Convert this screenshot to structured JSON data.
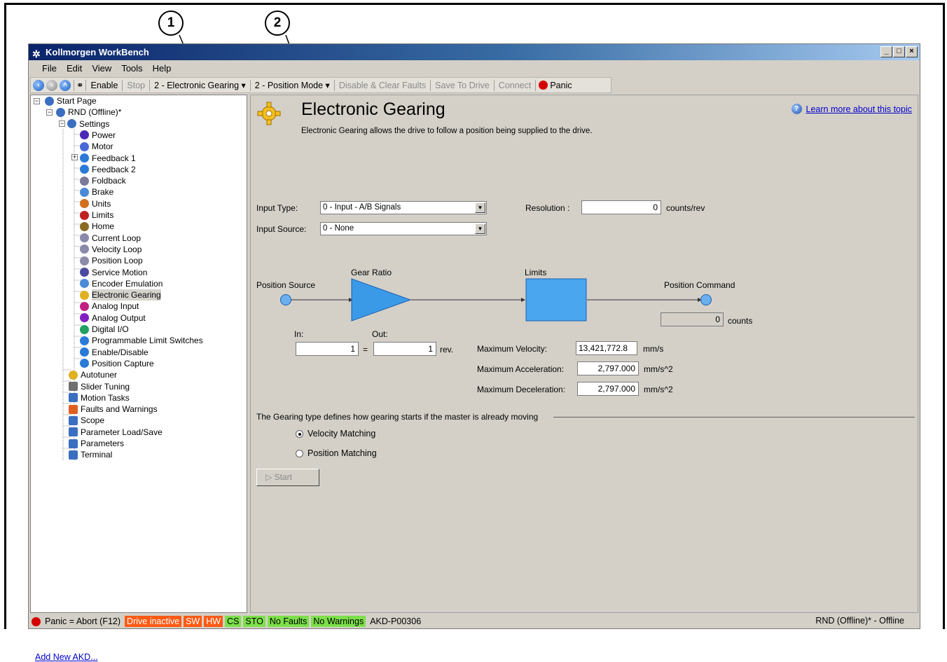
{
  "callouts": [
    "1",
    "2"
  ],
  "window": {
    "title": "Kollmorgen WorkBench",
    "controls": [
      "_",
      "□",
      "×"
    ]
  },
  "menu": [
    "File",
    "Edit",
    "View",
    "Tools",
    "Help"
  ],
  "toolbar": {
    "enable": "Enable",
    "stop": "Stop",
    "mode1": "2 - Electronic Gearing ▾",
    "mode2": "2 - Position Mode ▾",
    "disable_clear": "Disable & Clear Faults",
    "save": "Save To Drive",
    "connect": "Connect",
    "panic": "Panic"
  },
  "tree": [
    {
      "label": "Start Page",
      "icon": "start-page-icon",
      "color": "#3a6ec0"
    },
    {
      "label": "RND (Offline)*",
      "icon": "drive-icon",
      "color": "#3a6ec0"
    },
    {
      "label": "Settings",
      "icon": "settings-icon",
      "color": "#3a6ec0"
    },
    {
      "label": "Power",
      "icon": "power-icon",
      "color": "#4a2ab8"
    },
    {
      "label": "Motor",
      "icon": "motor-icon",
      "color": "#4a6ad8"
    },
    {
      "label": "Feedback 1",
      "icon": "feedback-icon",
      "color": "#2a7ad8"
    },
    {
      "label": "Feedback 2",
      "icon": "feedback-icon",
      "color": "#2a7ad8"
    },
    {
      "label": "Foldback",
      "icon": "foldback-icon",
      "color": "#7a7a9a"
    },
    {
      "label": "Brake",
      "icon": "brake-icon",
      "color": "#4a8ad8"
    },
    {
      "label": "Units",
      "icon": "units-icon",
      "color": "#d07020"
    },
    {
      "label": "Limits",
      "icon": "limits-icon",
      "color": "#c02020"
    },
    {
      "label": "Home",
      "icon": "home-icon",
      "color": "#8a6a20"
    },
    {
      "label": "Current Loop",
      "icon": "current-loop-icon",
      "color": "#8a8aaa"
    },
    {
      "label": "Velocity Loop",
      "icon": "velocity-loop-icon",
      "color": "#8a8aaa"
    },
    {
      "label": "Position Loop",
      "icon": "position-loop-icon",
      "color": "#8a8aaa"
    },
    {
      "label": "Service Motion",
      "icon": "service-motion-icon",
      "color": "#4a4aa0"
    },
    {
      "label": "Encoder Emulation",
      "icon": "encoder-emulation-icon",
      "color": "#4a8ad8"
    },
    {
      "label": "Electronic Gearing",
      "icon": "electronic-gearing-icon",
      "color": "#e0b020"
    },
    {
      "label": "Analog Input",
      "icon": "analog-input-icon",
      "color": "#c02080"
    },
    {
      "label": "Analog Output",
      "icon": "analog-output-icon",
      "color": "#8020c0"
    },
    {
      "label": "Digital I/O",
      "icon": "digital-io-icon",
      "color": "#20a060"
    },
    {
      "label": "Programmable Limit Switches",
      "icon": "limit-switch-icon",
      "color": "#2a7ad8"
    },
    {
      "label": "Enable/Disable",
      "icon": "enable-disable-icon",
      "color": "#2a7ad8"
    },
    {
      "label": "Position Capture",
      "icon": "position-capture-icon",
      "color": "#2a7ad8"
    },
    {
      "label": "Autotuner",
      "icon": "autotuner-icon",
      "color": "#e0b020"
    },
    {
      "label": "Slider Tuning",
      "icon": "slider-tuning-icon",
      "color": "#707070"
    },
    {
      "label": "Motion Tasks",
      "icon": "motion-tasks-icon",
      "color": "#3a6ec0"
    },
    {
      "label": "Faults and Warnings",
      "icon": "faults-icon",
      "color": "#e06020"
    },
    {
      "label": "Scope",
      "icon": "scope-icon",
      "color": "#3a6ec0"
    },
    {
      "label": "Parameter Load/Save",
      "icon": "save-icon",
      "color": "#3a6ec0"
    },
    {
      "label": "Parameters",
      "icon": "parameters-icon",
      "color": "#3a6ec0"
    },
    {
      "label": "Terminal",
      "icon": "terminal-icon",
      "color": "#3a6ec0"
    }
  ],
  "add_link": "Add New AKD...",
  "page": {
    "title": "Electronic Gearing",
    "description": "Electronic Gearing allows the drive to follow a position being supplied to the drive.",
    "help": "Learn more about this topic",
    "input_type_label": "Input Type:",
    "input_type_value": "0 - Input - A/B Signals",
    "input_source_label": "Input Source:",
    "input_source_value": "0 - None",
    "resolution_label": "Resolution :",
    "resolution_value": "0",
    "resolution_unit": "counts/rev",
    "diagram": {
      "position_source": "Position Source",
      "gear_ratio": "Gear Ratio",
      "limits": "Limits",
      "position_command": "Position Command",
      "command_value": "0",
      "command_unit": "counts",
      "in_label": "In:",
      "out_label": "Out:",
      "in_value": "1",
      "out_value": "1",
      "equals": "=",
      "rev": "rev."
    },
    "max_velocity_label": "Maximum Velocity:",
    "max_velocity_value": "13,421,772.8",
    "max_velocity_unit": "mm/s",
    "max_accel_label": "Maximum Acceleration:",
    "max_accel_value": "2,797.000",
    "max_accel_unit": "mm/s^2",
    "max_decel_label": "Maximum Deceleration:",
    "max_decel_value": "2,797.000",
    "max_decel_unit": "mm/s^2",
    "gearing_group_label": "The Gearing type defines how gearing starts if the master is already moving",
    "velocity_matching": "Velocity Matching",
    "position_matching": "Position Matching",
    "start_button": "Start"
  },
  "status": {
    "panic": "Panic = Abort (F12)",
    "drive_inactive": "Drive inactive",
    "sw": "SW",
    "hw": "HW",
    "cs": "CS",
    "sto": "STO",
    "no_faults": "No Faults",
    "no_warnings": "No Warnings",
    "model": "AKD-P00306",
    "right": "RND (Offline)* - Offline"
  }
}
